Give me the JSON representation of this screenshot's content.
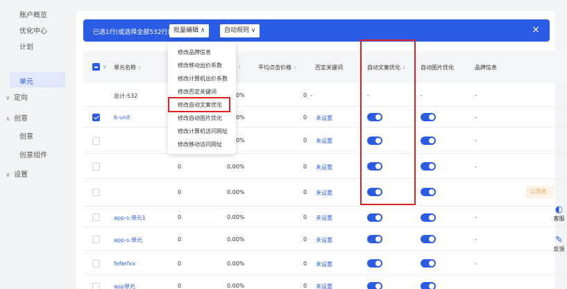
{
  "sidebar": {
    "items": [
      {
        "label": "账户概览"
      },
      {
        "label": "优化中心"
      },
      {
        "label": "计划"
      },
      {
        "label": "单元"
      },
      {
        "label": "定向"
      },
      {
        "label": "创意"
      },
      {
        "label": "创意"
      },
      {
        "label": "创意组件"
      },
      {
        "label": "设置"
      }
    ]
  },
  "toolbar": {
    "selection_text": "已选1行(或选择全部532行)",
    "batch_edit_label": "批量编辑",
    "auto_rule_label": "自动规则",
    "close_label": "×"
  },
  "batch_menu": {
    "items": [
      "修改品牌信息",
      "修改移动出价系数",
      "修改计算机出价系数",
      "修改否定关键词",
      "修改自动文案优化",
      "修改自动图片优化",
      "修改计算机访问网址",
      "修改移动访问网址"
    ]
  },
  "table": {
    "columns": [
      "单元名称",
      "平均点击价格",
      "否定关键词",
      "自动文案优化",
      "自动图片优化",
      "品牌信息"
    ],
    "total_row": {
      "name": "总计-532",
      "ctr": "0%",
      "avg_cpc": "0",
      "neg_kw": "-",
      "auto_text": "-",
      "auto_img": "-",
      "brand": "-"
    },
    "rows": [
      {
        "name": "6-unit",
        "clicks": "",
        "ctr": "0%",
        "avg_cpc": "0",
        "neg_kw": "未设置",
        "brand": "-"
      },
      {
        "name": "",
        "clicks": "",
        "ctr": "0%",
        "avg_cpc": "0",
        "neg_kw": "未设置",
        "brand": "-"
      },
      {
        "name": "",
        "clicks": "0",
        "ctr": "0.00%",
        "avg_cpc": "0",
        "neg_kw": "未设置",
        "brand": "-"
      },
      {
        "name": "",
        "clicks": "0",
        "ctr": "0.00%",
        "avg_cpc": "0",
        "neg_kw": "未设置",
        "brand": ""
      },
      {
        "name": "app-s-单元1",
        "clicks": "0",
        "ctr": "0.00%",
        "avg_cpc": "0",
        "neg_kw": "未设置",
        "brand": "-"
      },
      {
        "name": "app-s-单元",
        "clicks": "0",
        "ctr": "0.00%",
        "avg_cpc": "0",
        "neg_kw": "未设置",
        "brand": "-"
      },
      {
        "name": "feferfxx",
        "clicks": "0",
        "ctr": "0.00%",
        "avg_cpc": "0",
        "neg_kw": "未设置",
        "brand": "-"
      },
      {
        "name": "app单元",
        "clicks": "0",
        "ctr": "0.00%",
        "avg_cpc": "0",
        "neg_kw": "未设置",
        "brand": ""
      }
    ],
    "brand_tag": "公司名"
  },
  "float_buttons": [
    {
      "label": "客服",
      "icon": "headset-icon"
    },
    {
      "label": "反馈",
      "icon": "edit-icon"
    }
  ],
  "colors": {
    "accent": "#2b5ce6",
    "highlight": "#e02020",
    "tag": "#e8a04a"
  }
}
